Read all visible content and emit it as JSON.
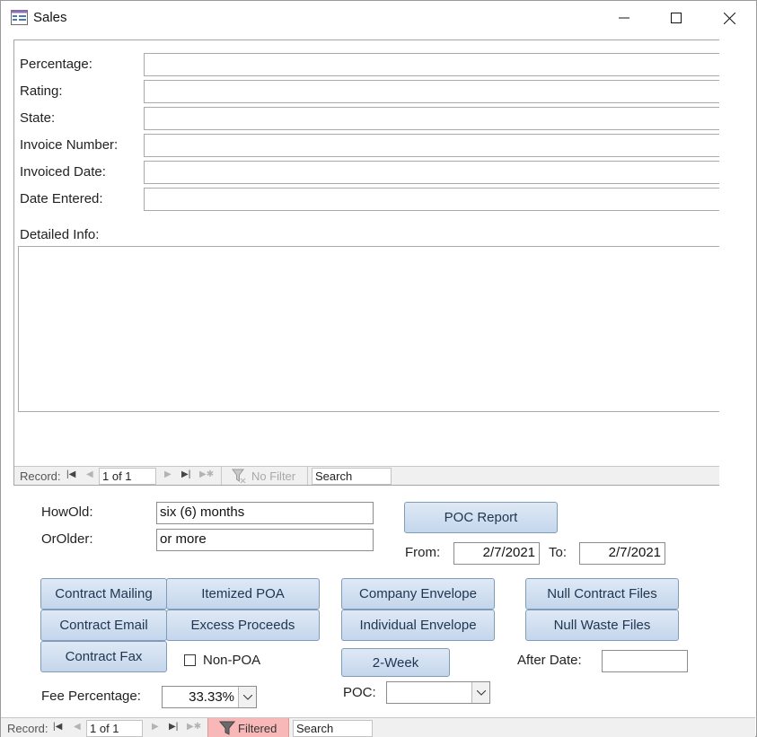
{
  "window": {
    "title": "Sales"
  },
  "subform": {
    "fields": [
      {
        "label": "Percentage:",
        "value": ""
      },
      {
        "label": "Rating:",
        "value": ""
      },
      {
        "label": "State:",
        "value": ""
      },
      {
        "label": "Invoice Number:",
        "value": ""
      },
      {
        "label": "Invoiced Date:",
        "value": ""
      },
      {
        "label": "Date Entered:",
        "value": ""
      }
    ],
    "detailed_info_label": "Detailed Info:",
    "detailed_info_value": "",
    "nav": {
      "record_label": "Record:",
      "position": "1 of 1",
      "filter_label": "No Filter",
      "search_placeholder": "Search"
    }
  },
  "main": {
    "howold_label": "HowOld:",
    "howold_value": "six (6) months",
    "orolder_label": "OrOlder:",
    "orolder_value": "or more",
    "poc_report_button": "POC Report",
    "from_label": "From:",
    "from_value": "2/7/2021",
    "to_label": "To:",
    "to_value": "2/7/2021",
    "buttons": {
      "contract_mailing": "Contract Mailing",
      "itemized_poa": "Itemized POA",
      "company_envelope": "Company Envelope",
      "null_contract_files": "Null Contract Files",
      "contract_email": "Contract Email",
      "excess_proceeds": "Excess Proceeds",
      "individual_envelope": "Individual Envelope",
      "null_waste_files": "Null Waste Files",
      "contract_fax": "Contract Fax",
      "two_week": "2-Week"
    },
    "non_poa_label": "Non-POA",
    "non_poa_checked": false,
    "after_date_label": "After Date:",
    "after_date_value": "",
    "fee_percentage_label": "Fee Percentage:",
    "fee_percentage_value": "33.33%",
    "poc_label": "POC:",
    "poc_value": ""
  },
  "bottom_nav": {
    "record_label": "Record:",
    "position": "1 of 1",
    "filter_label": "Filtered",
    "search_placeholder": "Search"
  },
  "colors": {
    "button_fill": "#c4d6ec",
    "button_border": "#7f9db9",
    "filtered_bg": "#f9b8b8"
  },
  "icons": [
    "form-icon",
    "minimize-icon",
    "maximize-icon",
    "close-icon",
    "first-record-icon",
    "previous-record-icon",
    "next-record-icon",
    "last-record-icon",
    "new-record-icon",
    "filter-icon",
    "dropdown-arrow-icon"
  ]
}
